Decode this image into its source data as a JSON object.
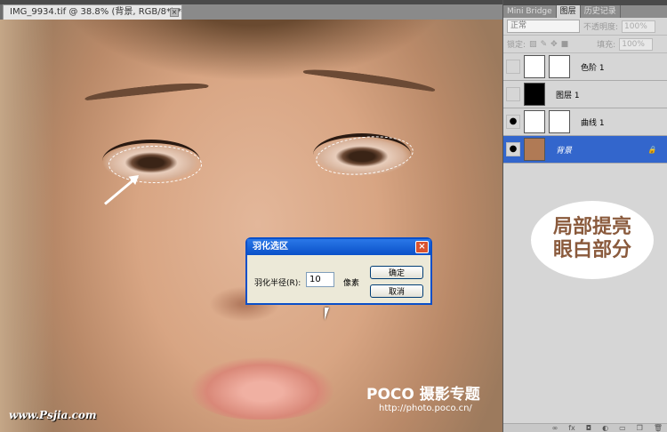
{
  "document": {
    "tab_title": "IMG_9934.tif @ 38.8% (背景, RGB/8*) *",
    "close": "×"
  },
  "canvas": {
    "watermark_left": "www.Psjia.com",
    "watermark_brand": "POCO 摄影专题",
    "watermark_url": "http://photo.poco.cn/"
  },
  "dialog": {
    "title": "羽化选区",
    "radius_label": "羽化半径(R):",
    "radius_value": "10",
    "unit": "像素",
    "ok": "确定",
    "cancel": "取消",
    "close": "×"
  },
  "panel": {
    "tabs": [
      "Mini Bridge",
      "图层",
      "历史记录"
    ],
    "blend_mode": "正常",
    "opacity_label": "不透明度:",
    "opacity": "100%",
    "lock_label": "锁定:",
    "fill_label": "填充:",
    "fill": "100%",
    "layers": [
      {
        "name": "色阶 1",
        "visible": false
      },
      {
        "name": "图层 1",
        "visible": false
      },
      {
        "name": "曲线 1",
        "visible": true
      },
      {
        "name": "背景",
        "visible": true,
        "selected": true
      }
    ]
  },
  "annotation": {
    "line1": "局部提亮",
    "line2": "眼白部分"
  }
}
